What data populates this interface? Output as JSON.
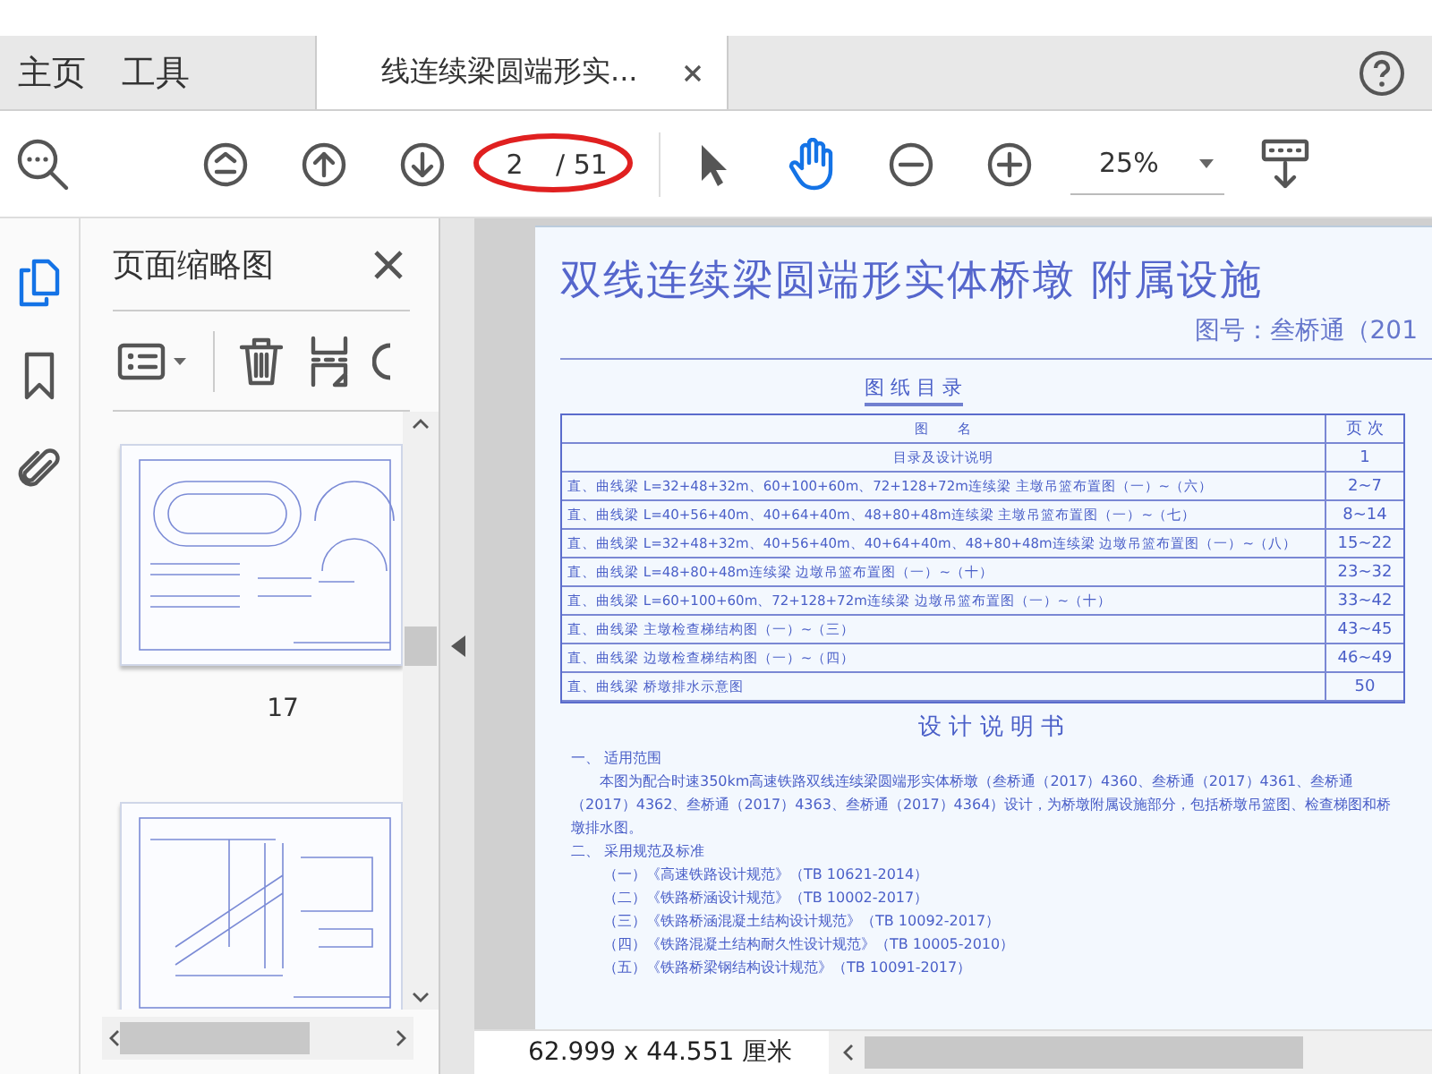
{
  "tabs": [
    {
      "label": "主页",
      "selected": false,
      "kind": "plain"
    },
    {
      "label": "工具",
      "selected": false,
      "kind": "plain"
    },
    {
      "label": "线连续梁圆端形实...",
      "selected": true,
      "kind": "document"
    }
  ],
  "toolbar": {
    "page_current": "2",
    "page_total": "/ 51",
    "zoom": "25%",
    "tools": [
      {
        "kind": "select",
        "selected": false
      },
      {
        "kind": "hand",
        "selected": true
      }
    ]
  },
  "rail": [
    {
      "kind": "pages",
      "selected": true
    },
    {
      "kind": "bookmark",
      "selected": false
    },
    {
      "kind": "attachment",
      "selected": false
    }
  ],
  "thumbnails": {
    "title": "页面缩略图",
    "pages": [
      {
        "label": "17",
        "kind": "ring"
      },
      {
        "kind": "bracket"
      }
    ]
  },
  "document": {
    "title": "双线连续梁圆端形实体桥墩 附属设施",
    "drawing_number": "图号：叁桥通（201",
    "contents_title": "图 纸 目 录",
    "columns": [
      "图　　名",
      "页 次"
    ],
    "rows": [
      {
        "name": "目录及设计说明",
        "pages": "1"
      },
      {
        "name": "直、曲线梁 L=32+48+32m、60+100+60m、72+128+72m连续梁 主墩吊篮布置图（一）~（六）",
        "pages": "2~7"
      },
      {
        "name": "直、曲线梁 L=40+56+40m、40+64+40m、48+80+48m连续梁 主墩吊篮布置图（一）~（七）",
        "pages": "8~14"
      },
      {
        "name": "直、曲线梁 L=32+48+32m、40+56+40m、40+64+40m、48+80+48m连续梁 边墩吊篮布置图（一）~（八）",
        "pages": "15~22"
      },
      {
        "name": "直、曲线梁 L=48+80+48m连续梁 边墩吊篮布置图（一）~（十）",
        "pages": "23~32"
      },
      {
        "name": "直、曲线梁 L=60+100+60m、72+128+72m连续梁 边墩吊篮布置图（一）~（十）",
        "pages": "33~42"
      },
      {
        "name": "直、曲线梁 主墩检查梯结构图（一）~（三）",
        "pages": "43~45"
      },
      {
        "name": "直、曲线梁 边墩检查梯结构图（一）~（四）",
        "pages": "46~49"
      },
      {
        "name": "直、曲线梁 桥墩排水示意图",
        "pages": "50"
      }
    ],
    "notes_title": "设 计 说 明 书",
    "notes": [
      {
        "kind": "heading",
        "text": "一、 适用范围"
      },
      {
        "kind": "paragraph",
        "text": "本图为配合时速350km高速铁路双线连续梁圆端形实体桥墩（叁桥通（2017）4360、叁桥通（2017）4361、叁桥通（2017）4362、叁桥通（2017）4363、叁桥通（2017）4364）设计，为桥墩附属设施部分，包括桥墩吊篮图、检查梯图和桥墩排水图。"
      },
      {
        "kind": "heading",
        "text": "二、 采用规范及标准"
      },
      {
        "kind": "item",
        "text": "（一）《高速铁路设计规范》（TB 10621-2014）"
      },
      {
        "kind": "item",
        "text": "（二）《铁路桥涵设计规范》（TB 10002-2017）"
      },
      {
        "kind": "item",
        "text": "（三）《铁路桥涵混凝土结构设计规范》（TB 10092-2017）"
      },
      {
        "kind": "item",
        "text": "（四）《铁路混凝土结构耐久性设计规范》（TB 10005-2010）"
      },
      {
        "kind": "item",
        "text": "（五）《铁路桥梁钢结构设计规范》（TB 10091-2017）"
      }
    ]
  },
  "status_bar": {
    "page_size": "62.999 x 44.551 厘米"
  }
}
